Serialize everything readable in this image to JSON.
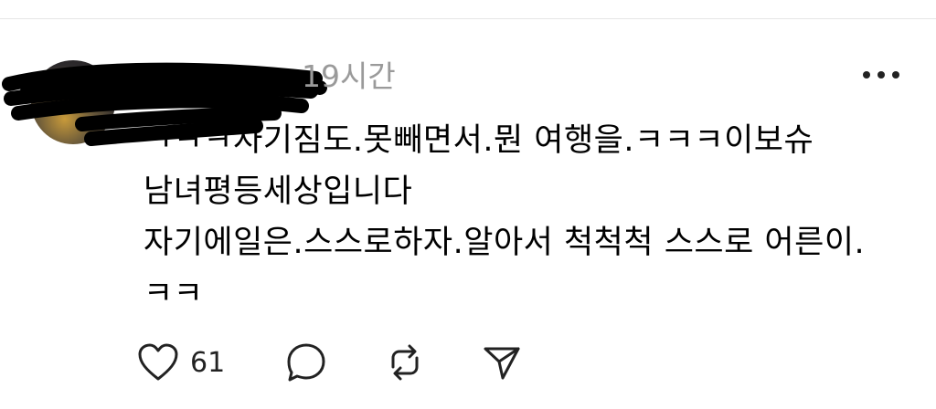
{
  "post": {
    "time": "19시간",
    "body": "ㅋㅋㅋ자기짐도.못빼면서.뭔 여행을.ㅋㅋㅋ이보슈\n남녀평등세상입니다\n자기에일은.스스로하자.알아서 척척척 스스로 어른이.\nㅋㅋ",
    "like_count": "61"
  },
  "icons": {
    "more": "more-horizontal-icon",
    "like": "heart-icon",
    "comment": "speech-bubble-icon",
    "repost": "repost-icon",
    "share": "send-icon"
  }
}
